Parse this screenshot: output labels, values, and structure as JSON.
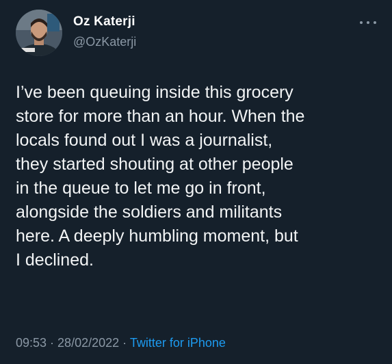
{
  "author": {
    "name": "Oz Katerji",
    "handle": "@OzKaterji",
    "avatar_icon": "profile-photo"
  },
  "more_icon": "more-options-icon",
  "tweet": {
    "lines": [
      "I’ve been queuing inside this grocery",
      "store for more than an hour. When the",
      "locals found out I was a journalist,",
      "they started shouting at other people",
      "in the queue to let me go in front,",
      "alongside the soldiers and militants",
      "here. A deeply humbling moment, but",
      "I declined."
    ]
  },
  "meta": {
    "time": "09:53",
    "separator": " · ",
    "date": "28/02/2022",
    "source": "Twitter for iPhone"
  },
  "colors": {
    "background": "#15202b",
    "text": "#f2f4f5",
    "secondary": "#8b98a5",
    "link": "#1d9bf0"
  }
}
